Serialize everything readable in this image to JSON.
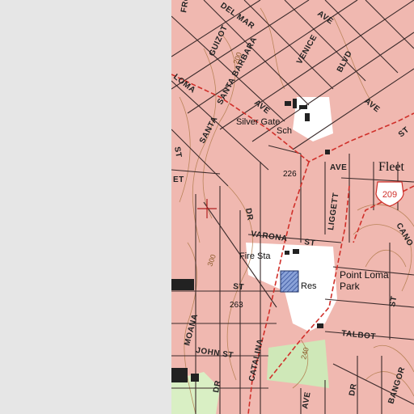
{
  "map": {
    "colors": {
      "urban_fill": "#f0b8b0",
      "street_line": "#3a2a2a",
      "major_road": "#d0302a",
      "contour": "#b07a4a",
      "park_green": "#c8e6b0",
      "reservoir_hatch": "#4466aa",
      "blank": "#e6e6e6"
    },
    "street_labels": {
      "ave_top": "AVE",
      "del_mar": "DEL MAR",
      "frontier": "FRO",
      "guizot": "GUIZOT",
      "santa_barbara": "SANTA BARBARA",
      "venice": "VENICE",
      "blvd": "BLVD",
      "loma": "LOMA",
      "ave_loma": "AVE",
      "ave_right": "AVE",
      "santa": "SANTA",
      "st_left": "ST",
      "dr_mid": "DR",
      "ave_fleet": "AVE",
      "liggett": "LIGGETT",
      "varona": "VARONA",
      "st_varona": "ST",
      "st_mid": "ST",
      "modana": "MOANA",
      "john_st": "JOHN ST",
      "dr_bottom": "DR",
      "catalina": "CATALINA",
      "talbot": "TALBOT",
      "bangor": "BANGOR",
      "canon": "CANO",
      "st_right": "ST",
      "dr_right": "DR",
      "ave_bottom": "AVE",
      "st_topright": "ST",
      "et_left": "ET"
    },
    "feature_labels": {
      "school": "Silver Gate",
      "school_abbr": "Sch",
      "fleet": "Fleet",
      "fire_station": "Fire Sta",
      "reservoir": "Res",
      "park_name": "Point Loma",
      "park": "Park"
    },
    "contour_labels": {
      "c200_top": "200",
      "c300": "300",
      "c240": "240"
    },
    "elevation_labels": {
      "e226": "226",
      "e263": "263"
    },
    "route_shield": "209"
  }
}
